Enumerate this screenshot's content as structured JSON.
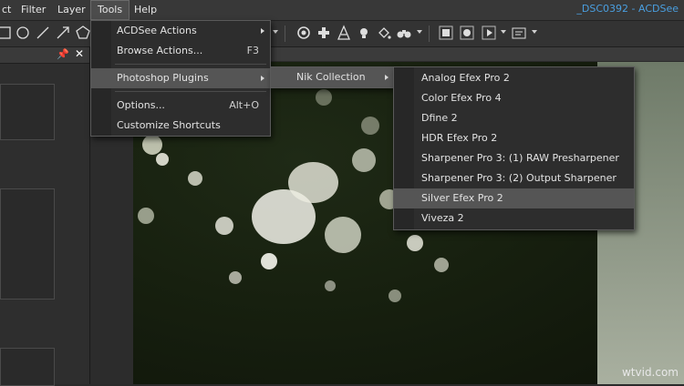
{
  "menubar": {
    "items": [
      "ct",
      "Filter",
      "Layer",
      "Tools",
      "Help"
    ],
    "window_title": "_DSC0392 - ACDSee"
  },
  "tools_menu": {
    "items": [
      {
        "label": "ACDSee Actions",
        "shortcut": "",
        "submenu": true
      },
      {
        "label": "Browse Actions...",
        "shortcut": "F3",
        "submenu": false
      },
      {
        "label": "Photoshop Plugins",
        "shortcut": "",
        "submenu": true
      },
      {
        "label": "Options...",
        "shortcut": "Alt+O",
        "submenu": false
      },
      {
        "label": "Customize Shortcuts",
        "shortcut": "",
        "submenu": false
      }
    ]
  },
  "plugins_menu": {
    "items": [
      {
        "label": "Nik Collection",
        "submenu": true
      }
    ]
  },
  "nik_menu": {
    "items": [
      "Analog Efex Pro 2",
      "Color Efex Pro 4",
      "Dfine 2",
      "HDR Efex Pro 2",
      "Sharpener Pro 3: (1) RAW Presharpener",
      "Sharpener Pro 3: (2) Output Sharpener",
      "Silver Efex Pro 2",
      "Viveza 2"
    ],
    "highlighted": "Silver Efex Pro 2"
  },
  "toolbar_icons": [
    "rectangle-select-icon",
    "ellipse-select-icon",
    "line-icon",
    "arrow-icon",
    "polygon-icon",
    "red-eye-icon",
    "heal-icon",
    "sharpen-icon",
    "light-icon",
    "fill-icon",
    "binoculars-icon",
    "stop-icon",
    "record-icon",
    "play-icon",
    "batch-icon"
  ],
  "watermark": "wtvid.com"
}
